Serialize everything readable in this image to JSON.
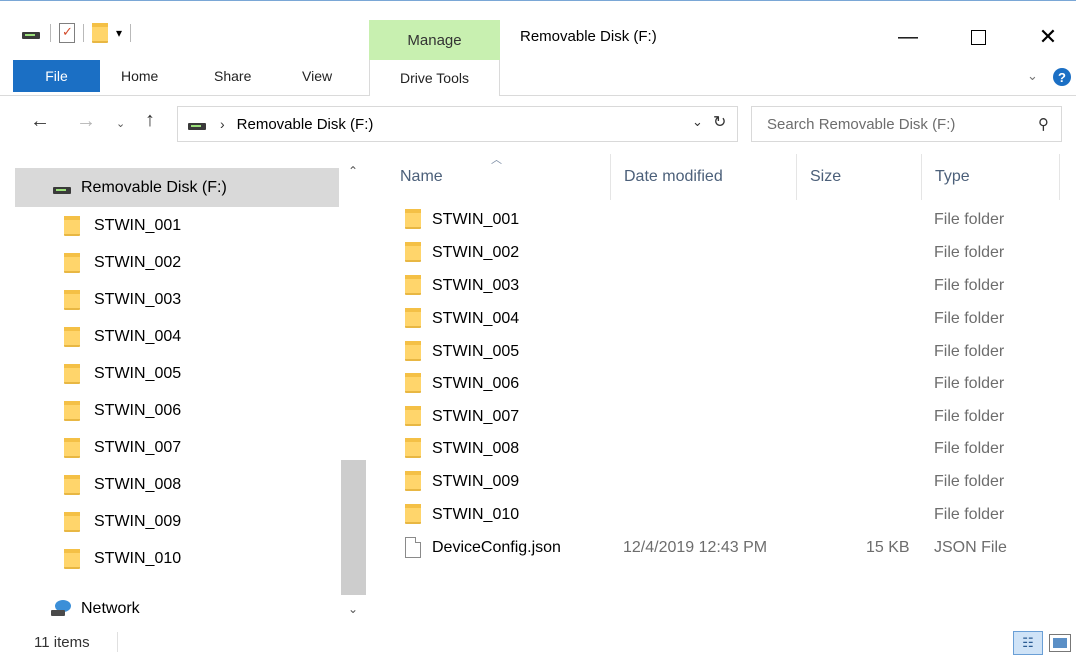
{
  "window": {
    "title": "Removable Disk (F:)",
    "contextual_tab_group": "Manage",
    "minimize_glyph": "—",
    "close_glyph": "✕"
  },
  "quick_access": {
    "dropdown_glyph": "▾"
  },
  "ribbon": {
    "tabs": {
      "file": "File",
      "home": "Home",
      "share": "Share",
      "view": "View",
      "drive_tools": "Drive Tools"
    },
    "collapse_glyph": "⌄",
    "help_glyph": "?"
  },
  "nav_buttons": {
    "back": "←",
    "forward": "→",
    "recent": "⌄",
    "up": "↑"
  },
  "address_bar": {
    "separator": "›",
    "crumb": "Removable Disk (F:)",
    "dropdown_glyph": "⌄",
    "refresh_glyph": "↻"
  },
  "search": {
    "placeholder": "Search Removable Disk (F:)",
    "icon_glyph": "⚲"
  },
  "nav_pane": {
    "drive_label": "Removable Disk (F:)",
    "folders": [
      "STWIN_001",
      "STWIN_002",
      "STWIN_003",
      "STWIN_004",
      "STWIN_005",
      "STWIN_006",
      "STWIN_007",
      "STWIN_008",
      "STWIN_009",
      "STWIN_010"
    ],
    "network_label": "Network",
    "scroll_up_glyph": "⌃",
    "scroll_down_glyph": "⌄"
  },
  "file_list": {
    "columns": {
      "name": "Name",
      "date": "Date modified",
      "size": "Size",
      "type": "Type"
    },
    "sort_glyph": "︿",
    "rows": [
      {
        "name": "STWIN_001",
        "date": "",
        "size": "",
        "type": "File folder",
        "kind": "folder"
      },
      {
        "name": "STWIN_002",
        "date": "",
        "size": "",
        "type": "File folder",
        "kind": "folder"
      },
      {
        "name": "STWIN_003",
        "date": "",
        "size": "",
        "type": "File folder",
        "kind": "folder"
      },
      {
        "name": "STWIN_004",
        "date": "",
        "size": "",
        "type": "File folder",
        "kind": "folder"
      },
      {
        "name": "STWIN_005",
        "date": "",
        "size": "",
        "type": "File folder",
        "kind": "folder"
      },
      {
        "name": "STWIN_006",
        "date": "",
        "size": "",
        "type": "File folder",
        "kind": "folder"
      },
      {
        "name": "STWIN_007",
        "date": "",
        "size": "",
        "type": "File folder",
        "kind": "folder"
      },
      {
        "name": "STWIN_008",
        "date": "",
        "size": "",
        "type": "File folder",
        "kind": "folder"
      },
      {
        "name": "STWIN_009",
        "date": "",
        "size": "",
        "type": "File folder",
        "kind": "folder"
      },
      {
        "name": "STWIN_010",
        "date": "",
        "size": "",
        "type": "File folder",
        "kind": "folder"
      },
      {
        "name": "DeviceConfig.json",
        "date": "12/4/2019 12:43 PM",
        "size": "15 KB",
        "type": "JSON File",
        "kind": "file"
      }
    ]
  },
  "status_bar": {
    "item_count": "11 items",
    "details_view_glyph": "☷"
  },
  "colors": {
    "accent": "#1b6fc4",
    "manage_tab": "#c8f0b0",
    "selection": "#d9d9d9",
    "folder": "#ffd56b"
  }
}
